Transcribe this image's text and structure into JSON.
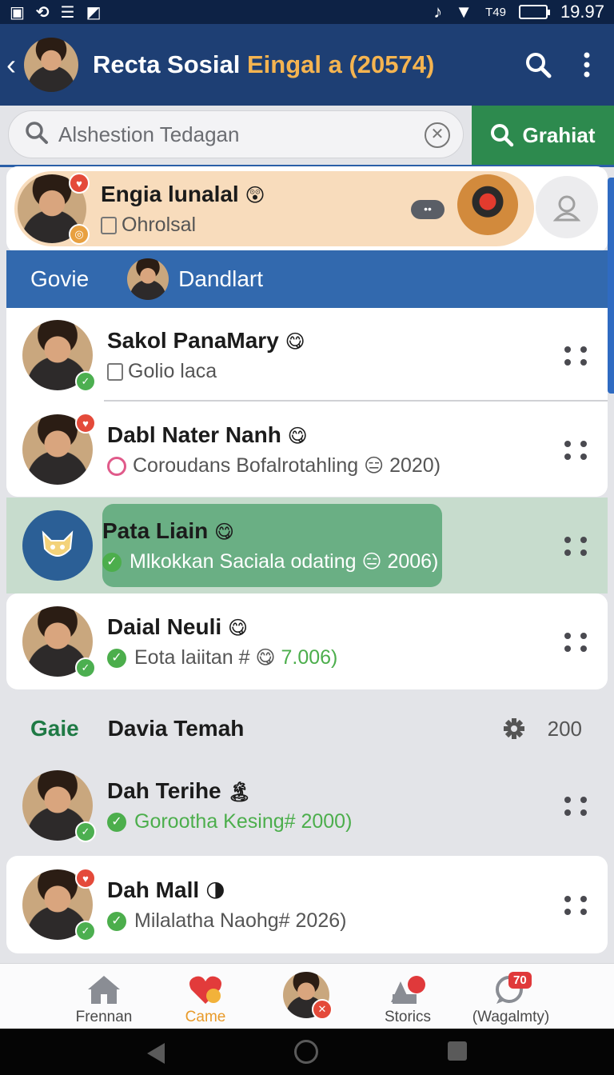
{
  "status_bar": {
    "left_icons": [
      "screenshot-icon",
      "sync-icon",
      "notifications-icon",
      "flag-icon"
    ],
    "network": "T49",
    "time": "19.97"
  },
  "app_bar": {
    "title": "Recta Sosial",
    "title_accent": "Eingal a (20574)",
    "accent_color": "#f5b450"
  },
  "search": {
    "placeholder": "Alshestion Tedagan",
    "button_label": "Grahiat"
  },
  "pinned_chat": {
    "name": "Engia lunalal",
    "name_emoji": "😲",
    "subtitle": "Ohrolsal",
    "typing_indicator": "••"
  },
  "tabs": [
    {
      "label": "Govie"
    },
    {
      "label": "Dandlart"
    }
  ],
  "chats": [
    {
      "name": "Sakol PanaMary",
      "emoji": "😋",
      "message": "Golio laca"
    },
    {
      "name": "Dabl Nater Nanh",
      "emoji": "😋",
      "message": "Coroudans Bofalrotahling",
      "msg_emoji": "😑",
      "meta": "2020)"
    },
    {
      "name": "Pata Liain",
      "emoji": "😋",
      "message": "Mlkokkan Saciala odating",
      "msg_emoji": "😑",
      "meta": "2006)"
    },
    {
      "name": "Daial Neuli",
      "emoji": "😋",
      "message": "Eota laiitan #",
      "msg_emoji": "😋",
      "meta": "7.006)"
    }
  ],
  "section": {
    "left_label": "Gaie",
    "title": "Davia Temah",
    "count": "200"
  },
  "chats_more": [
    {
      "name": "Dah Terihe",
      "emoji": "🏝",
      "message": "Gorootha Kesing# 2000)"
    },
    {
      "name": "Dah Mall",
      "emoji": "🌗",
      "message": "Milalatha Naohg# 2026)"
    }
  ],
  "bottom_nav": [
    {
      "label": "Frennan",
      "icon": "home-icon"
    },
    {
      "label": "Came",
      "icon": "heart-icon"
    },
    {
      "label": "",
      "icon": "profile-avatar"
    },
    {
      "label": "Storics",
      "icon": "stories-icon"
    },
    {
      "label": "(Wagalmty)",
      "icon": "message-icon",
      "badge": "70"
    }
  ]
}
